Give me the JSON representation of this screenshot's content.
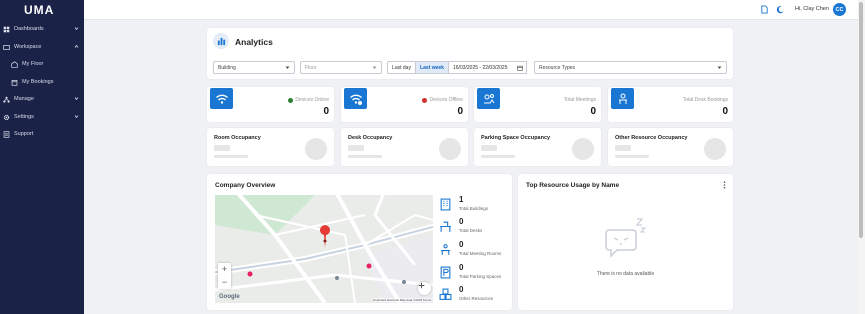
{
  "app": {
    "logo": "UMA"
  },
  "sidebar": {
    "items": [
      {
        "label": "Dashboards",
        "icon": "dashboard-icon"
      },
      {
        "label": "Workspace",
        "icon": "workspace-icon"
      },
      {
        "label": "My Floor",
        "icon": "floor-icon"
      },
      {
        "label": "My Bookings",
        "icon": "bookings-icon"
      },
      {
        "label": "Manage",
        "icon": "manage-icon"
      },
      {
        "label": "Settings",
        "icon": "gear-icon"
      },
      {
        "label": "Support",
        "icon": "support-icon"
      }
    ]
  },
  "topbar": {
    "greeting": "Hi, Clay Chen",
    "avatar_initials": "CC"
  },
  "header": {
    "title": "Analytics"
  },
  "filters": {
    "building": "Building",
    "floor": "Floor",
    "last_day": "Last day",
    "last_week": "Last week",
    "date_range": "16/03/2025 - 22/03/2025",
    "resource_types": "Resource Types"
  },
  "stats": [
    {
      "label": "Devices Online",
      "value": "0",
      "status_color": "#2e7d32"
    },
    {
      "label": "Devices Offline",
      "value": "0",
      "status_color": "#d32f2f"
    },
    {
      "label": "Total Meetings",
      "value": "0"
    },
    {
      "label": "Total Desk Bookings",
      "value": "0"
    }
  ],
  "occupancy": [
    {
      "title": "Room Occupancy"
    },
    {
      "title": "Desk Occupancy"
    },
    {
      "title": "Parking Space Occupancy"
    },
    {
      "title": "Other Resource Occupancy"
    }
  ],
  "overview": {
    "title": "Company Overview",
    "map": {
      "google": "Google",
      "attribution": "Keyboard shortcuts   Map data ©2025   Terms",
      "labels": [
        "Hoi Ki St",
        "Shing Yip St",
        "Hoi Bun Rd",
        "Hoi Yuen Rd",
        "Kwun Tong Rd",
        "Ren Min Hua Tang",
        "Hung To Rd",
        "Tai Yip St",
        "Chong Yip St",
        "Wai Yip St",
        "How Ming St",
        "Kwun Tong Promenade",
        "Goodman Rd",
        "Kwun Tong",
        "Hung To Rd"
      ]
    },
    "stats": [
      {
        "value": "1",
        "label": "Total Buildings",
        "icon": "building-icon"
      },
      {
        "value": "0",
        "label": "Total Desks",
        "icon": "desk-icon"
      },
      {
        "value": "0",
        "label": "Total Meeting Rooms",
        "icon": "meeting-room-icon"
      },
      {
        "value": "0",
        "label": "Total Parking Spaces",
        "icon": "parking-icon"
      },
      {
        "value": "0",
        "label": "Other Resources",
        "icon": "resources-icon"
      }
    ]
  },
  "resource_usage": {
    "title": "Top Resource Usage by Name",
    "empty_text": "There is no data available"
  },
  "colors": {
    "sidebar": "#1a2347",
    "accent": "#1976d2",
    "background": "#f0f1f5"
  }
}
